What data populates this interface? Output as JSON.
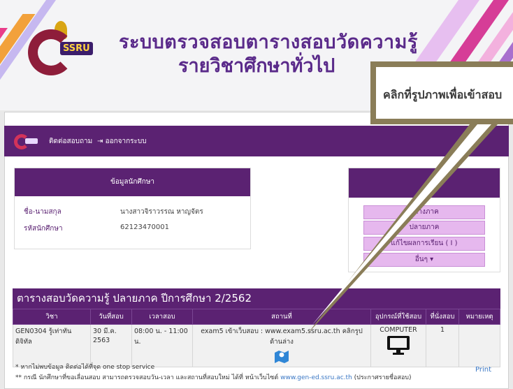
{
  "banner": {
    "title_line1": "ระบบตรวจสอบตารางสอบวัดความรู้",
    "title_line2": "รายวิชาศึกษาทั่วไป",
    "logo_text": "SSRU"
  },
  "nav": {
    "contact": "ติดต่อสอบถาม",
    "logout": "ออกจากระบบ",
    "logout_icon": "logout-icon"
  },
  "student": {
    "header": "ข้อมูลนักศึกษา",
    "name_label": "ชื่อ-นามสกุล",
    "name_value": "นางสาวจิราวรรณ หาญจัตร",
    "id_label": "รหัสนักศึกษา",
    "id_value": "62123470001"
  },
  "menu": {
    "items": [
      "กลางภาค",
      "ปลายภาค",
      "แก้ไขผลการเรียน ( I )",
      "อื่นๆ ▾"
    ]
  },
  "exam_section": {
    "title": "ตารางสอบวัดความรู้ ปลายภาค ปีการศึกษา 2/2562"
  },
  "table": {
    "headers": [
      "วิชา",
      "วันที่สอบ",
      "เวลาสอบ",
      "สถานที่",
      "อุปกรณ์ที่ใช้สอบ",
      "ที่นั่งสอบ",
      "หมายเหตุ"
    ],
    "row": {
      "subject": "GEN0304 รู้เท่าทันดิจิทัล",
      "date": "30 มี.ค. 2563",
      "time": "08:00 น. - 11:00 น.",
      "place": "exam5 เข้าเว็บสอบ : www.exam5.ssru.ac.th คลิกรูปด้านล่าง",
      "device": "COMPUTER",
      "seat": "1",
      "note": ""
    }
  },
  "notes": {
    "line1": "* หากไม่พบข้อมูล ติดต่อได้ที่จุด one stop service",
    "line2_prefix": "** กรณี นักศึกษาที่ขอเลื่อนสอบ สามารถตรวจสอบวัน-เวลา และสถานที่สอบใหม่ ได้ที่ หน้าเว็บไซต์ ",
    "line2_link": "www.gen-ed.ssru.ac.th",
    "line2_suffix": " (ประกาศรายชื่อสอบ)",
    "print": "Print"
  },
  "callout": {
    "text": "คลิกที่รูปภาพเพื่อเข้าสอบ"
  },
  "colors": {
    "primary": "#5b2272",
    "menu_bg": "#e6b8ee",
    "link": "#3b78c5"
  }
}
